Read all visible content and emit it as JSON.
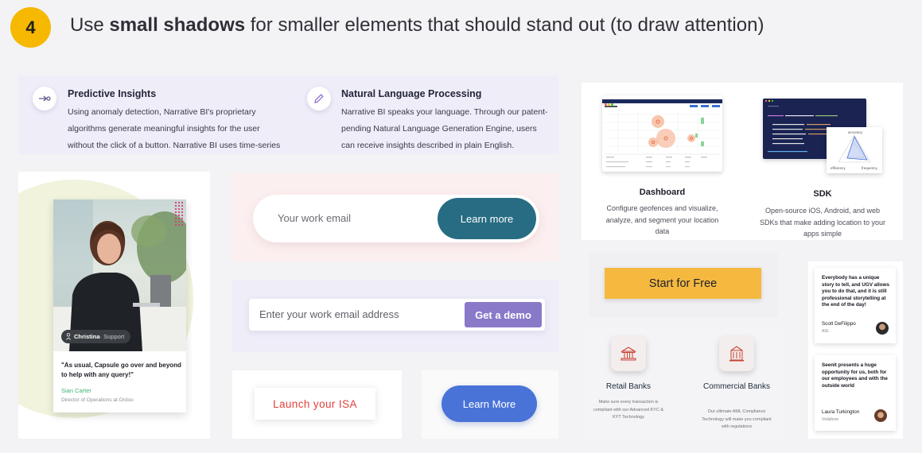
{
  "header": {
    "step": "4",
    "title_prefix": "Use ",
    "title_bold": "small shadows",
    "title_suffix": " for smaller elements that should stand out (to draw attention)"
  },
  "features": [
    {
      "icon": "arrow-right-circle-icon",
      "title": "Predictive Insights",
      "body": "Using anomaly detection, Narrative BI's proprietary algorithms generate meaningful insights for the user without the click of a button. Narrative BI uses time-series"
    },
    {
      "icon": "pencil-icon",
      "title": "Natural Language Processing",
      "body": "Narrative BI speaks your language. Through our patent-pending Natural Language Generation Engine, users can receive insights described in plain English."
    }
  ],
  "testimonial": {
    "name_pill": "Christina",
    "name_pill_role": " · Support",
    "quote": "\"As usual, Capsule go over and beyond to help with any query!\"",
    "author": "Sian Carter",
    "role": "Director of Operations at Ordoo"
  },
  "email_signup": {
    "placeholder": "Your work email",
    "button": "Learn more"
  },
  "demo_signup": {
    "placeholder": "Enter your work email address",
    "button": "Get a demo"
  },
  "isa": {
    "button": "Launch your ISA"
  },
  "blue_cta": {
    "button": "Learn More"
  },
  "products": [
    {
      "title": "Dashboard",
      "desc": "Configure geofences and visualize, analyze, and segment your location data"
    },
    {
      "title": "SDK",
      "desc": "Open-source iOS, Android, and web SDKs that make adding location to your apps simple"
    }
  ],
  "sdk_chart_labels": {
    "top": "accuracy",
    "left": "efficiency",
    "right": "frequency"
  },
  "start": {
    "button": "Start for Free"
  },
  "banks": [
    {
      "title": "Retail Banks",
      "desc": "Make sure every transaction is compliant with our Advanced KYC & KYT Technology"
    },
    {
      "title": "Commercial Banks",
      "desc": "Our ultimate AML Compliance Technology will make you compliant with regulations"
    }
  ],
  "quotes": [
    {
      "text": "Everybody has a unique story to tell, and UGV allows you to do that, and it is still professional storytelling at the end of the day!",
      "author": "Scott DeFilippo",
      "org": "AIG"
    },
    {
      "text": "Seenit presents a huge opportunity for us, both for our employees and with the outside world",
      "author": "Laura Turkington",
      "org": "Vodafone"
    }
  ],
  "colors": {
    "badge": "#f6b800",
    "learn_more": "#276c82",
    "get_demo": "#8979c8",
    "isa_text": "#e0413c",
    "blue_button": "#4a73d8",
    "start_button": "#f5b940"
  }
}
